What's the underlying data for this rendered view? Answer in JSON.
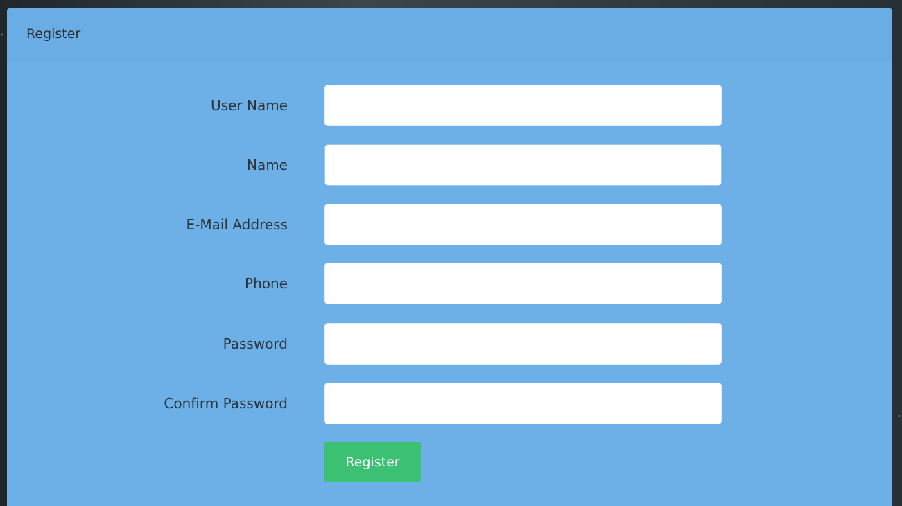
{
  "panel": {
    "title": "Register"
  },
  "form": {
    "fields": [
      {
        "label": "User Name",
        "value": "",
        "placeholder": ""
      },
      {
        "label": "Name",
        "value": "",
        "placeholder": ""
      },
      {
        "label": "E-Mail Address",
        "value": "",
        "placeholder": ""
      },
      {
        "label": "Phone",
        "value": "",
        "placeholder": ""
      },
      {
        "label": "Password",
        "value": "",
        "placeholder": ""
      },
      {
        "label": "Confirm Password",
        "value": "",
        "placeholder": ""
      }
    ],
    "submit_label": "Register"
  },
  "colors": {
    "panel_background": "#6cb0e7",
    "heading_background": "#69ade4",
    "button_background": "#3cc073",
    "page_background": "#2a3338"
  }
}
